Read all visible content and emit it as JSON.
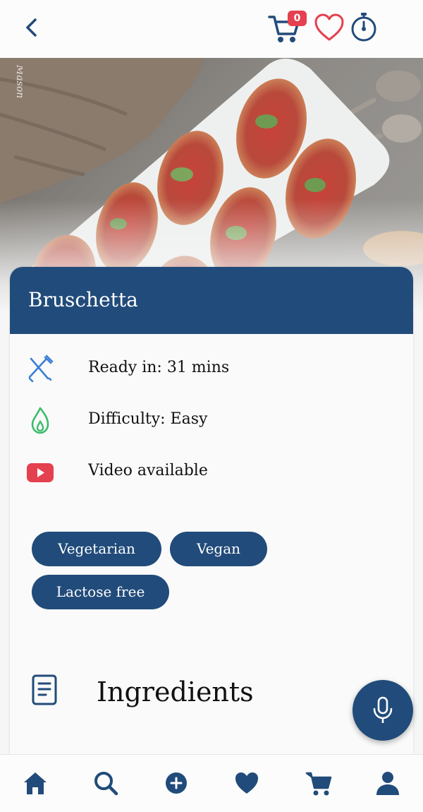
{
  "topbar": {
    "cart_count": "0"
  },
  "hero": {
    "watermark": "Mason"
  },
  "recipe": {
    "title": "Bruschetta",
    "info": [
      {
        "icon": "utensils-icon",
        "text": "Ready in: 31 mins"
      },
      {
        "icon": "flame-icon",
        "text": "Difficulty: Easy"
      },
      {
        "icon": "youtube-icon",
        "text": "Video available"
      }
    ],
    "tags": [
      "Vegetarian",
      "Vegan",
      "Lactose free"
    ],
    "section_title": "Ingredients"
  },
  "colors": {
    "primary": "#214b7a",
    "badge": "#e5404f",
    "heart": "#e5404f",
    "flame": "#3dbb6a",
    "utensils": "#3a7fd5",
    "video": "#e5404f"
  },
  "nav": [
    "home-icon",
    "search-icon",
    "add-icon",
    "favorites-icon",
    "cart-icon",
    "profile-icon"
  ]
}
